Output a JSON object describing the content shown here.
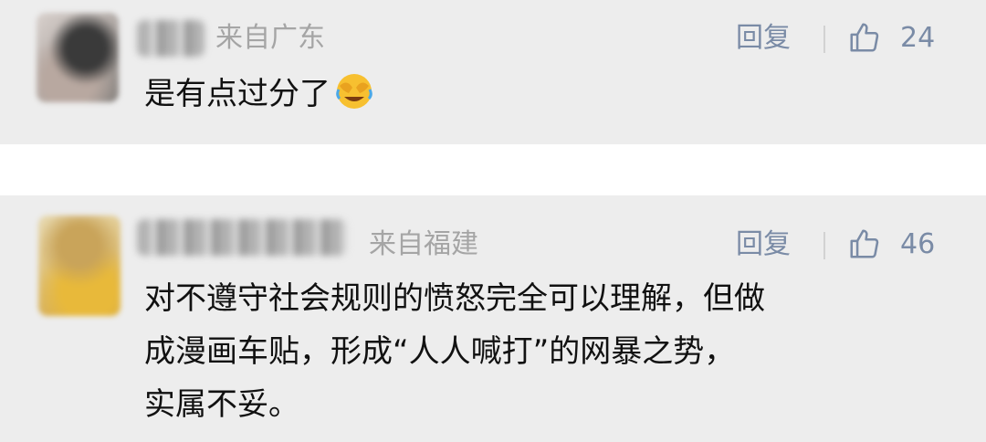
{
  "comments": [
    {
      "location": "来自广东",
      "reply_label": "回复",
      "likes": "24",
      "text": "是有点过分了",
      "emoji_icon": "face-with-tears-of-joy-covering-icon"
    },
    {
      "location": "来自福建",
      "reply_label": "回复",
      "likes": "46",
      "text_lines": [
        "对不遵守社会规则的愤怒完全可以理解，但做",
        "成漫画车贴，形成“人人喊打”的网暴之势，",
        "实属不妥。"
      ]
    }
  ],
  "colors": {
    "card_background": "#ededed",
    "meta_gray": "#a5a5a5",
    "action_blue_gray": "#7a8ba6",
    "text": "#111111"
  }
}
